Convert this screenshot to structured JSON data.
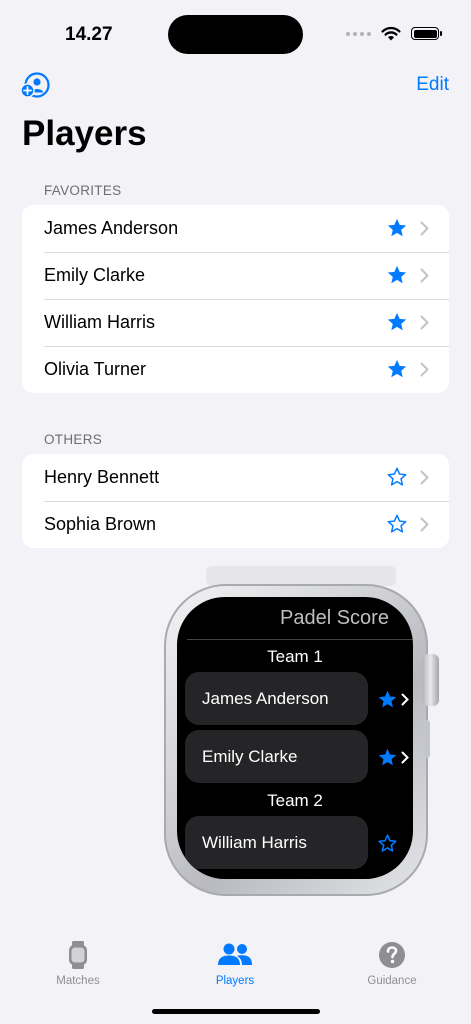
{
  "status_bar": {
    "time": "14.27"
  },
  "nav": {
    "edit_label": "Edit",
    "title": "Players"
  },
  "favorites": {
    "header": "FAVORITES",
    "players": [
      {
        "name": "James Anderson",
        "favorite": true
      },
      {
        "name": "Emily Clarke",
        "favorite": true
      },
      {
        "name": "William Harris",
        "favorite": true
      },
      {
        "name": "Olivia Turner",
        "favorite": true
      }
    ]
  },
  "others": {
    "header": "OTHERS",
    "players": [
      {
        "name": "Henry Bennett",
        "favorite": false
      },
      {
        "name": "Sophia Brown",
        "favorite": false
      }
    ]
  },
  "watch": {
    "app_title": "Padel Score",
    "team1_label": "Team 1",
    "team2_label": "Team 2",
    "rows": [
      {
        "name": "James Anderson",
        "favorite": true
      },
      {
        "name": "Emily Clarke",
        "favorite": true
      },
      {
        "name": "William Harris",
        "favorite": false
      }
    ]
  },
  "tabs": [
    {
      "label": "Matches",
      "icon": "watch-icon",
      "selected": false
    },
    {
      "label": "Players",
      "icon": "people-icon",
      "selected": true
    },
    {
      "label": "Guidance",
      "icon": "question-circle-icon",
      "selected": false
    }
  ],
  "colors": {
    "accent": "#007aff",
    "inactive": "#8e8e93",
    "background": "#f2f2f7"
  }
}
